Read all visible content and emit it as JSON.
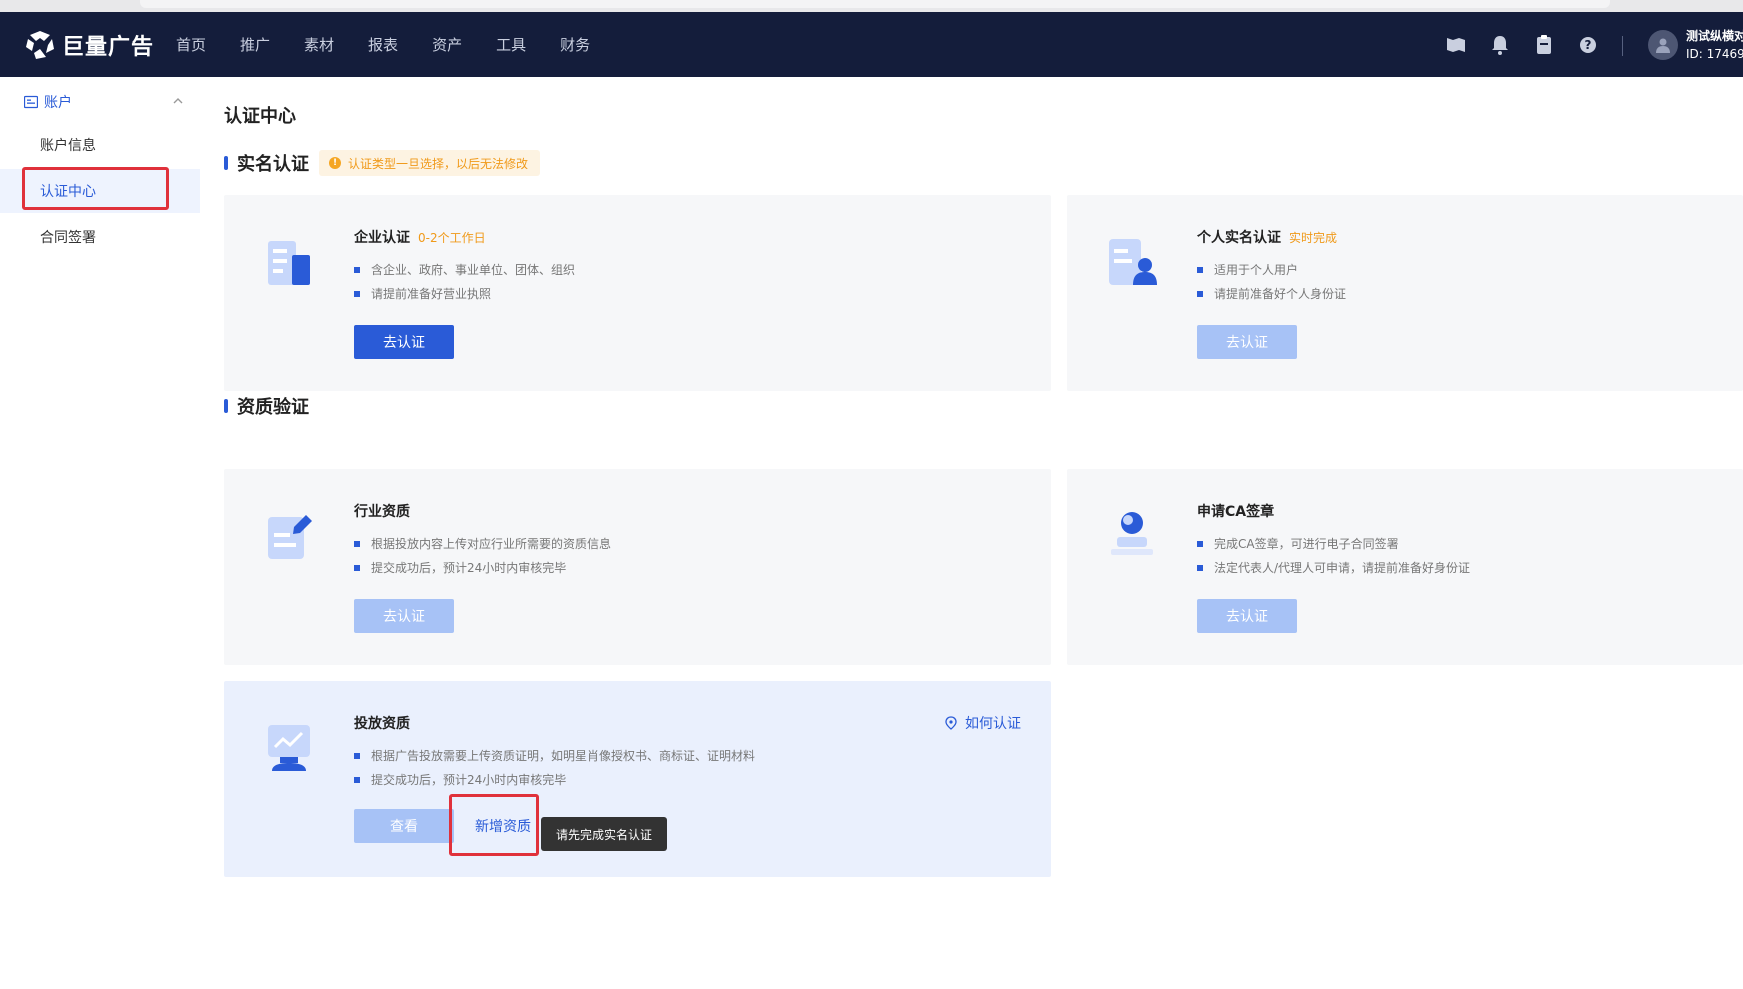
{
  "brand": {
    "name": "巨量广告",
    "accent": "#2a5bd7",
    "nav_bg": "#141d3b",
    "warning": "#f09a1a",
    "highlight": "#e0313b"
  },
  "topnav": {
    "items": [
      "首页",
      "推广",
      "素材",
      "报表",
      "资产",
      "工具",
      "财务"
    ],
    "icons": [
      "flag-icon",
      "bell-icon",
      "clipboard-icon",
      "help-icon"
    ],
    "user": {
      "name": "测试纵横对",
      "id": "ID: 17469"
    }
  },
  "sidebar": {
    "group": "账户",
    "items": [
      {
        "label": "账户信息",
        "active": false
      },
      {
        "label": "认证中心",
        "active": true
      },
      {
        "label": "合同签署",
        "active": false
      }
    ]
  },
  "main": {
    "page_title": "认证中心",
    "realname": {
      "title": "实名认证",
      "notice": "认证类型一旦选择，以后无法修改",
      "cards": [
        {
          "title": "企业认证",
          "tag": "0-2个工作日",
          "bullets": [
            "含企业、政府、事业单位、团体、组织",
            "请提前准备好营业执照"
          ],
          "button": "去认证",
          "icon": "building-icon"
        },
        {
          "title": "个人实名认证",
          "tag": "实时完成",
          "bullets": [
            "适用于个人用户",
            "请提前准备好个人身份证"
          ],
          "button": "去认证",
          "icon": "person-id-icon"
        }
      ]
    },
    "qualification": {
      "title": "资质验证",
      "cards": [
        {
          "title": "行业资质",
          "bullets": [
            "根据投放内容上传对应行业所需要的资质信息",
            "提交成功后，预计24小时内审核完毕"
          ],
          "button": "去认证",
          "icon": "document-pen-icon"
        },
        {
          "title": "申请CA签章",
          "bullets": [
            "完成CA签章，可进行电子合同签署",
            "法定代表人/代理人可申请，请提前准备好身份证"
          ],
          "button": "去认证",
          "icon": "stamp-icon"
        },
        {
          "title": "投放资质",
          "bullets": [
            "根据广告投放需要上传资质证明，如明星肖像授权书、商标证、证明材料",
            "提交成功后，预计24小时内审核完毕"
          ],
          "view_button": "查看",
          "add_button": "新增资质",
          "howto": "如何认证",
          "tooltip": "请先完成实名认证",
          "icon": "chart-board-icon"
        }
      ]
    }
  }
}
